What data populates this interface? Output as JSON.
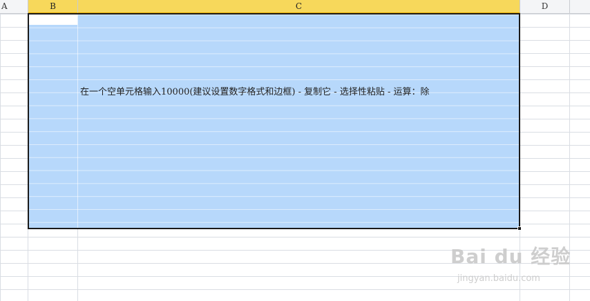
{
  "columns": [
    {
      "label": "A",
      "selected": false
    },
    {
      "label": "B",
      "selected": true
    },
    {
      "label": "C",
      "selected": true
    },
    {
      "label": "D",
      "selected": false
    }
  ],
  "cell_text": "在一个空单元格输入10000(建议设置数字格式和边框) - 复制它 - 选择性粘贴 - 运算：除",
  "colors": {
    "selection_fill": "#b7d8fb",
    "selected_header": "#f7d85b",
    "gridline": "#d9dde3"
  },
  "watermark": {
    "logo": "Bai du 经验",
    "url": "jingyan.baidu.com",
    "icon": "paw-icon"
  }
}
